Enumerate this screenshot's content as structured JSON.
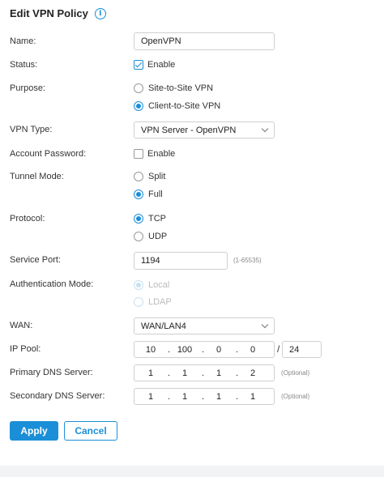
{
  "title": "Edit VPN Policy",
  "labels": {
    "name": "Name:",
    "status": "Status:",
    "purpose": "Purpose:",
    "vpn_type": "VPN Type:",
    "account_password": "Account Password:",
    "tunnel_mode": "Tunnel Mode:",
    "protocol": "Protocol:",
    "service_port": "Service Port:",
    "auth_mode": "Authentication Mode:",
    "wan": "WAN:",
    "ip_pool": "IP Pool:",
    "primary_dns": "Primary DNS Server:",
    "secondary_dns": "Secondary DNS Server:"
  },
  "name_value": "OpenVPN",
  "status": {
    "label": "Enable",
    "checked": true
  },
  "purpose": {
    "options": [
      "Site-to-Site VPN",
      "Client-to-Site VPN"
    ],
    "selected": "Client-to-Site VPN"
  },
  "vpn_type": {
    "value": "VPN Server - OpenVPN"
  },
  "account_password": {
    "label": "Enable",
    "checked": false
  },
  "tunnel_mode": {
    "options": [
      "Split",
      "Full"
    ],
    "selected": "Full"
  },
  "protocol": {
    "options": [
      "TCP",
      "UDP"
    ],
    "selected": "TCP"
  },
  "service_port": {
    "value": "1194",
    "hint": "(1-65535)"
  },
  "auth_mode": {
    "options": [
      "Local",
      "LDAP"
    ],
    "selected": "Local",
    "disabled": true
  },
  "wan": {
    "value": "WAN/LAN4"
  },
  "ip_pool": {
    "octets": [
      "10",
      "100",
      "0",
      "0"
    ],
    "mask": "24"
  },
  "primary_dns": {
    "octets": [
      "1",
      "1",
      "1",
      "2"
    ],
    "hint": "(Optional)"
  },
  "secondary_dns": {
    "octets": [
      "1",
      "1",
      "1",
      "1"
    ],
    "hint": "(Optional)"
  },
  "buttons": {
    "apply": "Apply",
    "cancel": "Cancel"
  },
  "colors": {
    "accent": "#1a8fd8",
    "footer": "#f2f3f5"
  }
}
